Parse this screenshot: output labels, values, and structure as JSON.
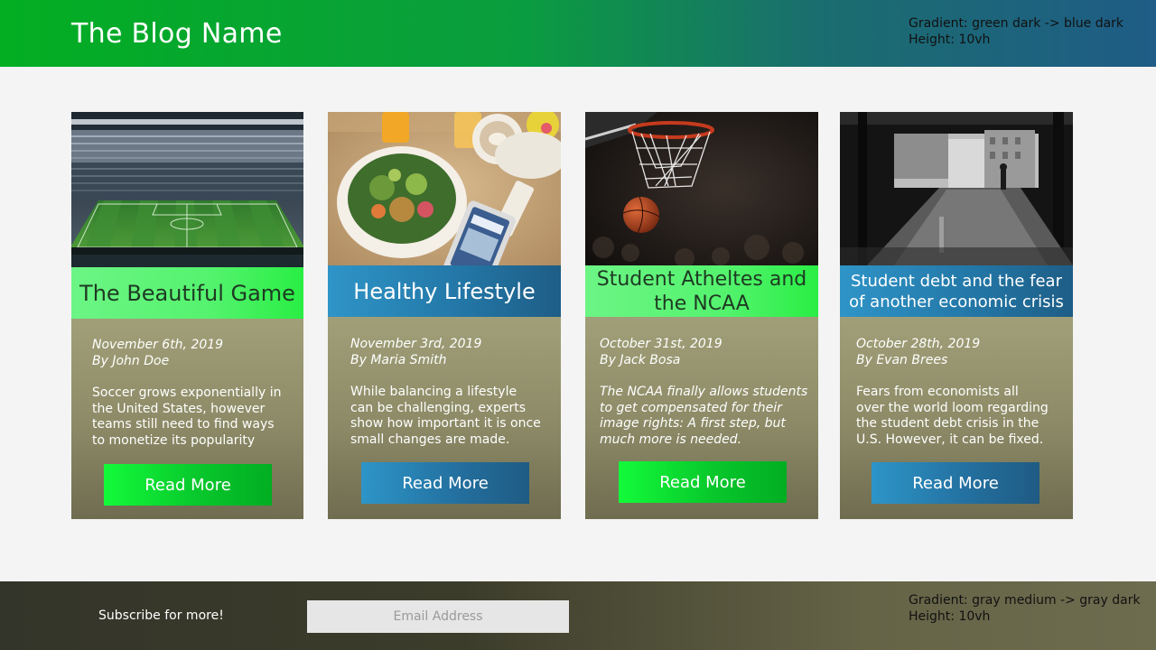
{
  "header": {
    "blog_name": "The Blog Name",
    "note_line1": "Gradient: green dark -> blue dark",
    "note_line2": "Height: 10vh"
  },
  "cards": [
    {
      "title": "The Beautiful Game",
      "date": "November 6th, 2019",
      "author": "By John Doe",
      "excerpt_lines": [
        "Soccer grows exponentially in",
        "the United States, however",
        "teams still need to find ways",
        "to monetize its popularity"
      ],
      "button_label": "Read More"
    },
    {
      "title": "Healthy Lifestyle",
      "date": "November 3rd, 2019",
      "author": "By Maria Smith",
      "excerpt_lines": [
        "While balancing a lifestyle",
        "can be challenging, experts",
        "show how important it is once",
        "small changes are made."
      ],
      "button_label": "Read More"
    },
    {
      "title_lines": [
        "Student Atheltes and",
        "the NCAA"
      ],
      "date": "October 31st, 2019",
      "author": "By Jack Bosa",
      "excerpt_lines": [
        "The NCAA finally allows students",
        "to get compensated for their",
        "image rights: A first step, but",
        "much more is needed."
      ],
      "button_label": "Read More"
    },
    {
      "title_lines": [
        "Student debt and the fear",
        "of another economic crisis"
      ],
      "date": "October 28th, 2019",
      "author": "By Evan Brees",
      "excerpt_lines": [
        "Fears from economists all",
        "over the world loom regarding",
        "the student debt crisis in the",
        "U.S. However, it can be fixed."
      ],
      "button_label": "Read More"
    }
  ],
  "footer": {
    "subscribe_label": "Subscribe for more!",
    "email_placeholder": "Email Address",
    "note_line1": "Gradient: gray medium -> gray dark",
    "note_line2": "Height: 10vh"
  },
  "colors": {
    "header_gradient": [
      "#03ae22",
      "#1f5c86"
    ],
    "footer_gradient": [
      "#34352a",
      "#6e6c4f"
    ],
    "accent_green": "#13fb3a",
    "accent_blue": "#2d95c8",
    "card_body": "#8e8c68"
  }
}
